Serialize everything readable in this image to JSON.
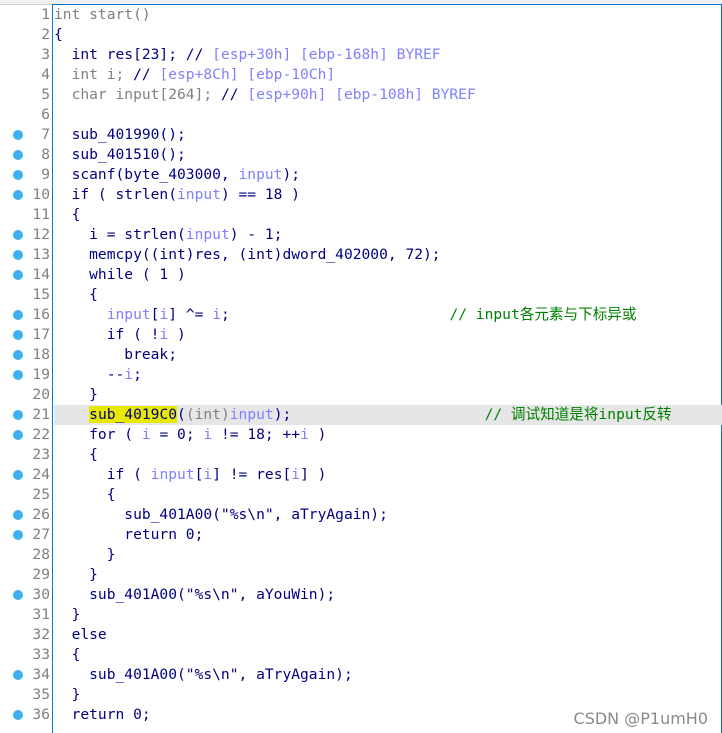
{
  "watermark": "CSDN @P1umH0",
  "breakpoint_color": "#3cb0f0",
  "highlighted_line": 21,
  "lines": [
    {
      "n": "1",
      "dot": false,
      "t": [
        [
          "int start()",
          "g"
        ]
      ]
    },
    {
      "n": "2",
      "dot": false,
      "t": [
        [
          "{",
          "n"
        ]
      ]
    },
    {
      "n": "3",
      "dot": false,
      "t": [
        [
          "  int res[23]; // ",
          "n"
        ],
        [
          "[esp+30h] [ebp-168h] BYREF",
          "c"
        ]
      ]
    },
    {
      "n": "4",
      "dot": false,
      "t": [
        [
          "  int i; ",
          "g"
        ],
        [
          "// ",
          "n"
        ],
        [
          "[esp+8Ch] [ebp-10Ch]",
          "c"
        ]
      ]
    },
    {
      "n": "5",
      "dot": false,
      "t": [
        [
          "  char input[264]; ",
          "g"
        ],
        [
          "// ",
          "n"
        ],
        [
          "[esp+90h] [ebp-108h] BYREF",
          "c"
        ]
      ]
    },
    {
      "n": "6",
      "dot": false,
      "t": []
    },
    {
      "n": "7",
      "dot": true,
      "t": [
        [
          "  sub_401990();",
          "n"
        ]
      ]
    },
    {
      "n": "8",
      "dot": true,
      "t": [
        [
          "  sub_401510();",
          "n"
        ]
      ]
    },
    {
      "n": "9",
      "dot": true,
      "t": [
        [
          "  scanf(byte_403000, ",
          "n"
        ],
        [
          "input",
          "v"
        ],
        [
          ");",
          "n"
        ]
      ]
    },
    {
      "n": "10",
      "dot": true,
      "t": [
        [
          "  if ( strlen(",
          "n"
        ],
        [
          "input",
          "v"
        ],
        [
          ") == 18 )",
          "n"
        ]
      ]
    },
    {
      "n": "11",
      "dot": false,
      "t": [
        [
          "  {",
          "n"
        ]
      ]
    },
    {
      "n": "12",
      "dot": true,
      "t": [
        [
          "    i = strlen(",
          "n"
        ],
        [
          "input",
          "v"
        ],
        [
          ") - 1;",
          "n"
        ]
      ]
    },
    {
      "n": "13",
      "dot": true,
      "t": [
        [
          "    memcpy((int)res, (int)dword_402000, 72);",
          "n"
        ]
      ]
    },
    {
      "n": "14",
      "dot": true,
      "t": [
        [
          "    while ( 1 )",
          "n"
        ]
      ]
    },
    {
      "n": "15",
      "dot": false,
      "t": [
        [
          "    {",
          "n"
        ]
      ]
    },
    {
      "n": "16",
      "dot": true,
      "t": [
        [
          "      ",
          "n"
        ],
        [
          "input",
          "v"
        ],
        [
          "[",
          "n"
        ],
        [
          "i",
          "v"
        ],
        [
          "] ^= ",
          "n"
        ],
        [
          "i",
          "v"
        ],
        [
          ";                         ",
          "n"
        ],
        [
          "// input各元素与下标异或",
          "k"
        ]
      ]
    },
    {
      "n": "17",
      "dot": true,
      "t": [
        [
          "      if ( !",
          "n"
        ],
        [
          "i",
          "v"
        ],
        [
          " )",
          "n"
        ]
      ]
    },
    {
      "n": "18",
      "dot": true,
      "t": [
        [
          "        break;",
          "n"
        ]
      ]
    },
    {
      "n": "19",
      "dot": true,
      "t": [
        [
          "      --",
          "n"
        ],
        [
          "i",
          "v"
        ],
        [
          ";",
          "n"
        ]
      ]
    },
    {
      "n": "20",
      "dot": false,
      "t": [
        [
          "    }",
          "n"
        ]
      ]
    },
    {
      "n": "21",
      "dot": true,
      "t": [
        [
          "    ",
          "n"
        ],
        [
          "sub_4019C0",
          "y"
        ],
        [
          "(",
          "n"
        ],
        [
          "(int)",
          "g"
        ],
        [
          "input",
          "v"
        ],
        [
          ");",
          "n"
        ],
        [
          "                      ",
          "n"
        ],
        [
          "// 调试知道是将input反转",
          "k"
        ]
      ]
    },
    {
      "n": "22",
      "dot": true,
      "t": [
        [
          "    for ( ",
          "n"
        ],
        [
          "i",
          "v"
        ],
        [
          " = 0; ",
          "n"
        ],
        [
          "i",
          "v"
        ],
        [
          " != 18; ++",
          "n"
        ],
        [
          "i",
          "v"
        ],
        [
          " )",
          "n"
        ]
      ]
    },
    {
      "n": "23",
      "dot": false,
      "t": [
        [
          "    {",
          "n"
        ]
      ]
    },
    {
      "n": "24",
      "dot": true,
      "t": [
        [
          "      if ( ",
          "n"
        ],
        [
          "input",
          "v"
        ],
        [
          "[",
          "n"
        ],
        [
          "i",
          "v"
        ],
        [
          "] != res[",
          "n"
        ],
        [
          "i",
          "v"
        ],
        [
          "] )",
          "n"
        ]
      ]
    },
    {
      "n": "25",
      "dot": false,
      "t": [
        [
          "      {",
          "n"
        ]
      ]
    },
    {
      "n": "26",
      "dot": true,
      "t": [
        [
          "        sub_401A00(\"%s\\n\", aTryAgain);",
          "n"
        ]
      ]
    },
    {
      "n": "27",
      "dot": true,
      "t": [
        [
          "        return 0;",
          "n"
        ]
      ]
    },
    {
      "n": "28",
      "dot": false,
      "t": [
        [
          "      }",
          "n"
        ]
      ]
    },
    {
      "n": "29",
      "dot": false,
      "t": [
        [
          "    }",
          "n"
        ]
      ]
    },
    {
      "n": "30",
      "dot": true,
      "t": [
        [
          "    sub_401A00(\"%s\\n\", aYouWin);",
          "n"
        ]
      ]
    },
    {
      "n": "31",
      "dot": false,
      "t": [
        [
          "  }",
          "n"
        ]
      ]
    },
    {
      "n": "32",
      "dot": false,
      "t": [
        [
          "  else",
          "n"
        ]
      ]
    },
    {
      "n": "33",
      "dot": false,
      "t": [
        [
          "  {",
          "n"
        ]
      ]
    },
    {
      "n": "34",
      "dot": true,
      "t": [
        [
          "    sub_401A00(\"%s\\n\", aTryAgain);",
          "n"
        ]
      ]
    },
    {
      "n": "35",
      "dot": false,
      "t": [
        [
          "  }",
          "n"
        ]
      ]
    },
    {
      "n": "36",
      "dot": true,
      "t": [
        [
          "  return 0;",
          "n"
        ]
      ]
    }
  ]
}
